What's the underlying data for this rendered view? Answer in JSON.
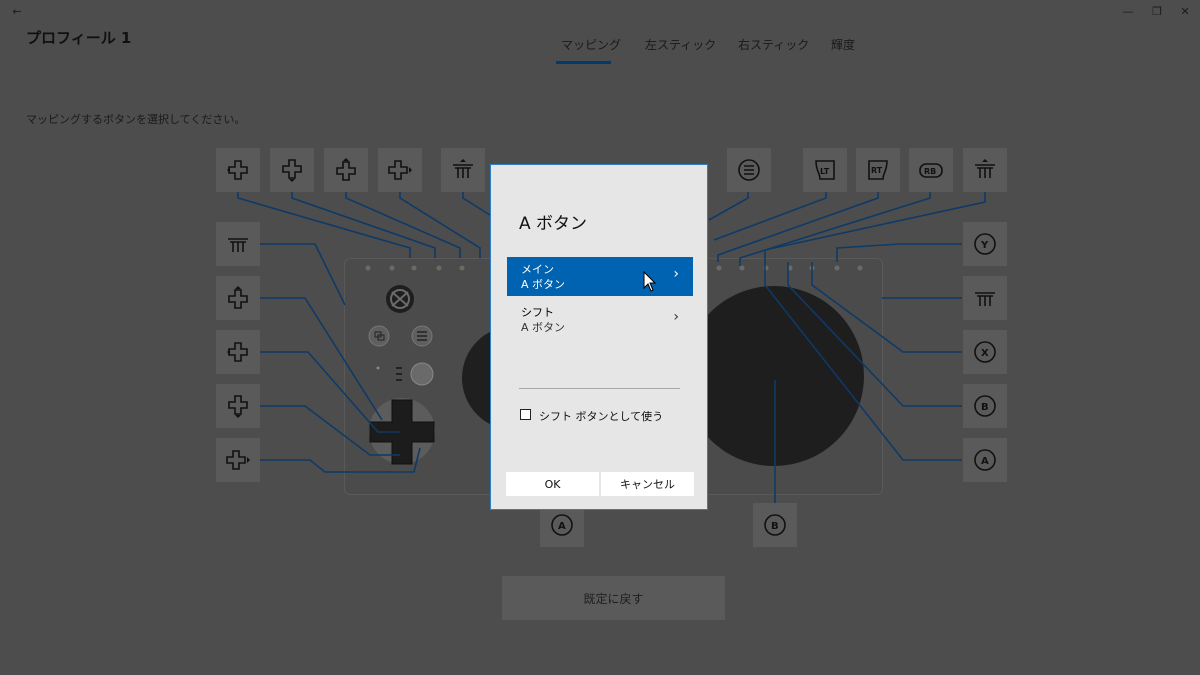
{
  "window": {
    "back": "←",
    "minimize": "—",
    "restore": "❐",
    "close": "✕"
  },
  "header": {
    "title": "プロフィール 1"
  },
  "tabs": [
    {
      "label": "マッピング"
    },
    {
      "label": "左スティック"
    },
    {
      "label": "右スティック"
    },
    {
      "label": "輝度"
    }
  ],
  "instruction": "マッピングするボタンを選択してください。",
  "top_buttons": [
    {
      "icon": "dpad-left-icon"
    },
    {
      "icon": "dpad-down-icon"
    },
    {
      "icon": "dpad-up-icon"
    },
    {
      "icon": "dpad-right-icon"
    },
    {
      "icon": "left-stick-press-icon"
    },
    {
      "icon": "view-button-icon"
    },
    {
      "icon": "dpad-up-icon"
    },
    {
      "icon": "circle-icon"
    },
    {
      "icon": "circle-icon"
    },
    {
      "icon": "menu-button-icon"
    },
    {
      "icon": "lt-trigger-icon",
      "text": "LT"
    },
    {
      "icon": "rt-trigger-icon",
      "text": "RT"
    },
    {
      "icon": "rb-bumper-icon",
      "text": "RB"
    },
    {
      "icon": "right-stick-press-icon"
    }
  ],
  "left_buttons": [
    {
      "icon": "left-stick-icon"
    },
    {
      "icon": "dpad-up-icon"
    },
    {
      "icon": "dpad-left-icon"
    },
    {
      "icon": "dpad-down-icon"
    },
    {
      "icon": "dpad-right-icon"
    }
  ],
  "right_buttons": [
    {
      "icon": "y-button-icon",
      "text": "Y"
    },
    {
      "icon": "right-stick-icon"
    },
    {
      "icon": "x-button-icon",
      "text": "X"
    },
    {
      "icon": "b-button-icon",
      "text": "B"
    },
    {
      "icon": "a-button-icon",
      "text": "A"
    }
  ],
  "bottom_buttons": [
    {
      "icon": "a-button-icon",
      "text": "A"
    },
    {
      "icon": "b-button-icon",
      "text": "B"
    }
  ],
  "reset_button": "既定に戻す",
  "dialog": {
    "title": "A ボタン",
    "main": {
      "label": "メイン",
      "value": "A ボタン"
    },
    "shift": {
      "label": "シフト",
      "value": "A ボタン"
    },
    "checkbox_label": "シフト ボタンとして使う",
    "ok": "OK",
    "cancel": "キャンセル"
  },
  "colors": {
    "accent": "#0063b1",
    "dialog_border": "#2f7fc8",
    "lines": "#0e3a66"
  }
}
